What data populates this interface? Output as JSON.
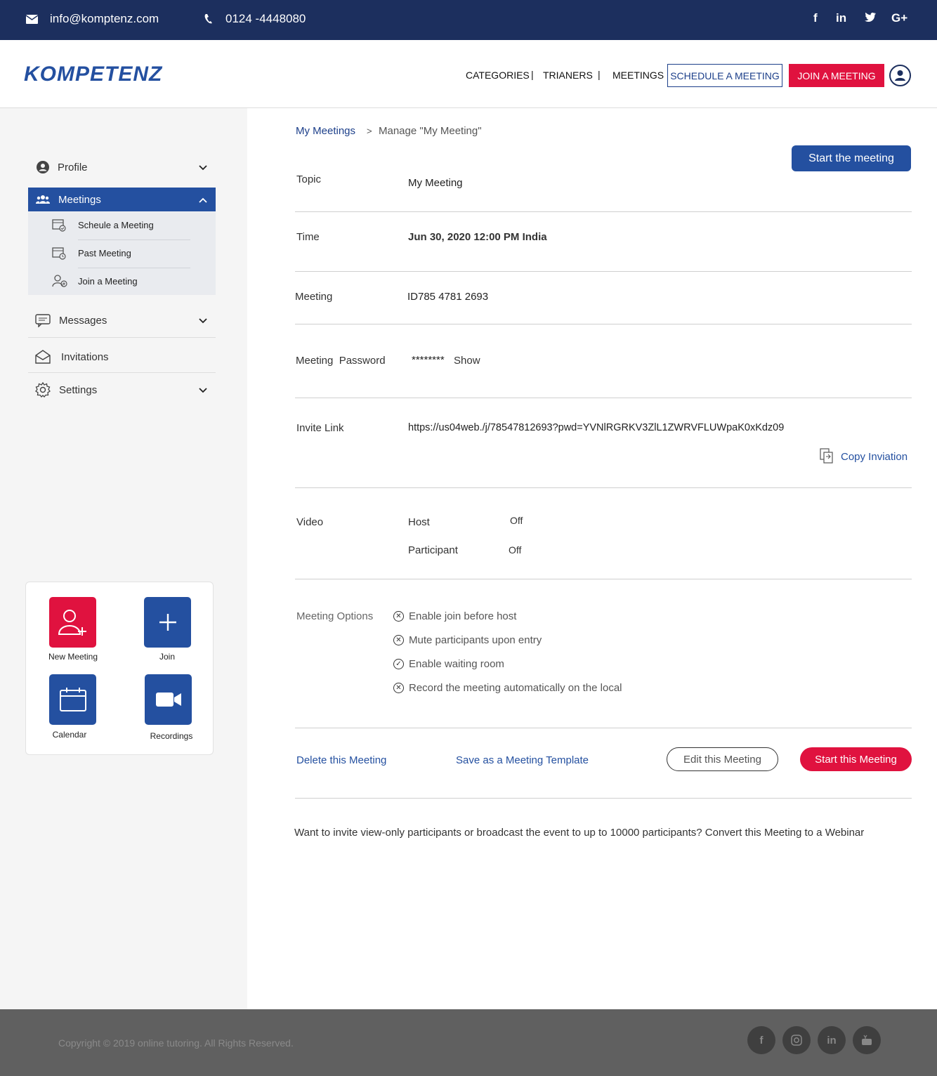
{
  "topbar": {
    "email": "info@komptenz.com",
    "phone": "0124 -4448080",
    "social": [
      "f",
      "in",
      "t",
      "G+"
    ]
  },
  "header": {
    "logo": "KOMPETENZ",
    "nav": [
      "CATEGORIES",
      "TRIANERS",
      "MEETINGS"
    ],
    "separator": "|",
    "schedule_btn": "SCHEDULE A MEETING",
    "join_btn": "JOIN A MEETING"
  },
  "sidebar": {
    "profile": "Profile",
    "meetings": "Meetings",
    "sub": [
      "Scheule a Meeting",
      "Past Meeting",
      "Join a Meeting"
    ],
    "messages": "Messages",
    "invitations": "Invitations",
    "settings": "Settings",
    "quick": {
      "new_meeting": "New Meeting",
      "join": "Join",
      "calendar": "Calendar",
      "recordings": "Recordings"
    }
  },
  "content": {
    "breadcrumb_root": "My Meetings",
    "breadcrumb_sep": ">",
    "breadcrumb_current": "Manage \"My Meeting\"",
    "start_btn": "Start the meeting",
    "topic_label": "Topic",
    "topic_value": "My Meeting",
    "time_label": "Time",
    "time_value": "Jun 30, 2020 12:00 PM India",
    "meeting_label": "Meeting",
    "meeting_value": "ID785 4781 2693",
    "password_label": "Meeting  Password",
    "password_value": "********",
    "password_show": "Show",
    "invite_label": "Invite Link",
    "invite_value": "https://us04web./j/78547812693?pwd=YVNlRGRKV3ZlL1ZWRVFLUWpaK0xKdz09",
    "copy_invitation": "Copy Inviation",
    "video_label": "Video",
    "video_host": "Host",
    "video_host_val": "Off",
    "video_participant": "Participant",
    "video_participant_val": "Off",
    "options_label": "Meeting Options",
    "options": [
      {
        "text": "Enable join before host",
        "state": "off"
      },
      {
        "text": "Mute participants upon entry",
        "state": "off"
      },
      {
        "text": "Enable waiting room",
        "state": "on"
      },
      {
        "text": "Record the meeting automatically on the local",
        "state": "off"
      }
    ],
    "delete": "Delete this Meeting",
    "save_template": "Save as a Meeting Template",
    "edit": "Edit this Meeting",
    "start_this": "Start this Meeting",
    "webinar_note": "Want to invite view-only participants or broadcast the event to up to 10000 participants? Convert this Meeting to a Webinar"
  },
  "footer": {
    "copyright": "Copyright © 2019 online tutoring. All Rights Reserved.",
    "social": [
      "f",
      "ig",
      "in",
      "yt"
    ]
  },
  "colors": {
    "navy": "#1c2f5e",
    "blue": "#2450a0",
    "red": "#e0123f",
    "footer": "#606060"
  }
}
